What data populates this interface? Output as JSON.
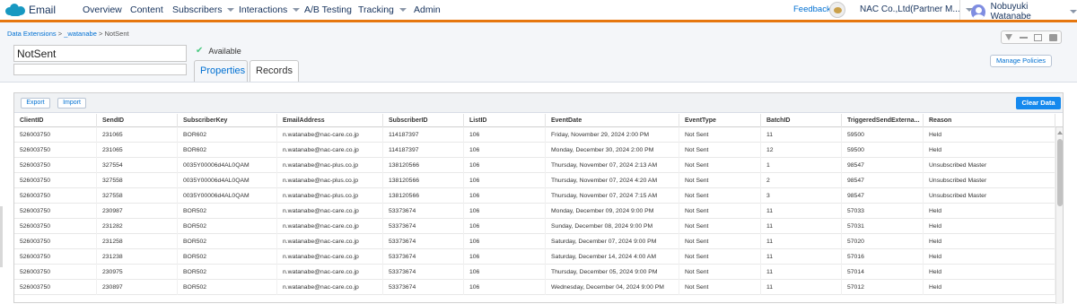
{
  "app": {
    "name": "Email"
  },
  "nav": {
    "overview": "Overview",
    "content": "Content",
    "subscribers": "Subscribers",
    "interactions": "Interactions",
    "ab_testing": "A/B Testing",
    "tracking": "Tracking",
    "admin": "Admin"
  },
  "topright": {
    "feedback": "Feedback",
    "account": "NAC Co.,Ltd(Partner M...",
    "user": "Nobuyuki Watanabe"
  },
  "breadcrumb": {
    "root": "Data Extensions",
    "sep": ">",
    "folder": "_watanabe",
    "current": "NotSent"
  },
  "de": {
    "name": "NotSent",
    "description": "",
    "status": "Available"
  },
  "tabs": {
    "properties": "Properties",
    "records": "Records"
  },
  "buttons": {
    "manage_policies": "Manage Policies",
    "export": "Export",
    "import": "Import",
    "clear_data": "Clear Data"
  },
  "table": {
    "columns": [
      "ClientID",
      "SendID",
      "SubscriberKey",
      "EmailAddress",
      "SubscriberID",
      "ListID",
      "EventDate",
      "EventType",
      "BatchID",
      "TriggeredSendExterna...",
      "Reason"
    ],
    "rows": [
      [
        "526003750",
        "231065",
        "BOR602",
        "n.watanabe@nac-care.co.jp",
        "114187397",
        "106",
        "Friday, November 29, 2024 2:00 PM",
        "Not Sent",
        "11",
        "59500",
        "Held"
      ],
      [
        "526003750",
        "231065",
        "BOR602",
        "n.watanabe@nac-care.co.jp",
        "114187397",
        "106",
        "Monday, December 30, 2024 2:00 PM",
        "Not Sent",
        "12",
        "59500",
        "Held"
      ],
      [
        "526003750",
        "327554",
        "0035Y00006d4AL0QAM",
        "n.watanabe@nac-plus.co.jp",
        "138120566",
        "106",
        "Thursday, November 07, 2024 2:13 AM",
        "Not Sent",
        "1",
        "98547",
        "Unsubscribed Master"
      ],
      [
        "526003750",
        "327558",
        "0035Y00006d4AL0QAM",
        "n.watanabe@nac-plus.co.jp",
        "138120566",
        "106",
        "Thursday, November 07, 2024 4:20 AM",
        "Not Sent",
        "2",
        "98547",
        "Unsubscribed Master"
      ],
      [
        "526003750",
        "327558",
        "0035Y00006d4AL0QAM",
        "n.watanabe@nac-plus.co.jp",
        "138120566",
        "106",
        "Thursday, November 07, 2024 7:15 AM",
        "Not Sent",
        "3",
        "98547",
        "Unsubscribed Master"
      ],
      [
        "526003750",
        "230987",
        "BOR502",
        "n.watanabe@nac-care.co.jp",
        "53373674",
        "106",
        "Monday, December 09, 2024 9:00 PM",
        "Not Sent",
        "11",
        "57033",
        "Held"
      ],
      [
        "526003750",
        "231282",
        "BOR502",
        "n.watanabe@nac-care.co.jp",
        "53373674",
        "106",
        "Sunday, December 08, 2024 9:00 PM",
        "Not Sent",
        "11",
        "57031",
        "Held"
      ],
      [
        "526003750",
        "231258",
        "BOR502",
        "n.watanabe@nac-care.co.jp",
        "53373674",
        "106",
        "Saturday, December 07, 2024 9:00 PM",
        "Not Sent",
        "11",
        "57020",
        "Held"
      ],
      [
        "526003750",
        "231238",
        "BOR502",
        "n.watanabe@nac-care.co.jp",
        "53373674",
        "106",
        "Saturday, December 14, 2024 4:00 AM",
        "Not Sent",
        "11",
        "57016",
        "Held"
      ],
      [
        "526003750",
        "230975",
        "BOR502",
        "n.watanabe@nac-care.co.jp",
        "53373674",
        "106",
        "Thursday, December 05, 2024 9:00 PM",
        "Not Sent",
        "11",
        "57014",
        "Held"
      ],
      [
        "526003750",
        "230897",
        "BOR502",
        "n.watanabe@nac-care.co.jp",
        "53373674",
        "106",
        "Wednesday, December 04, 2024 9:00 PM",
        "Not Sent",
        "11",
        "57012",
        "Held"
      ]
    ]
  }
}
